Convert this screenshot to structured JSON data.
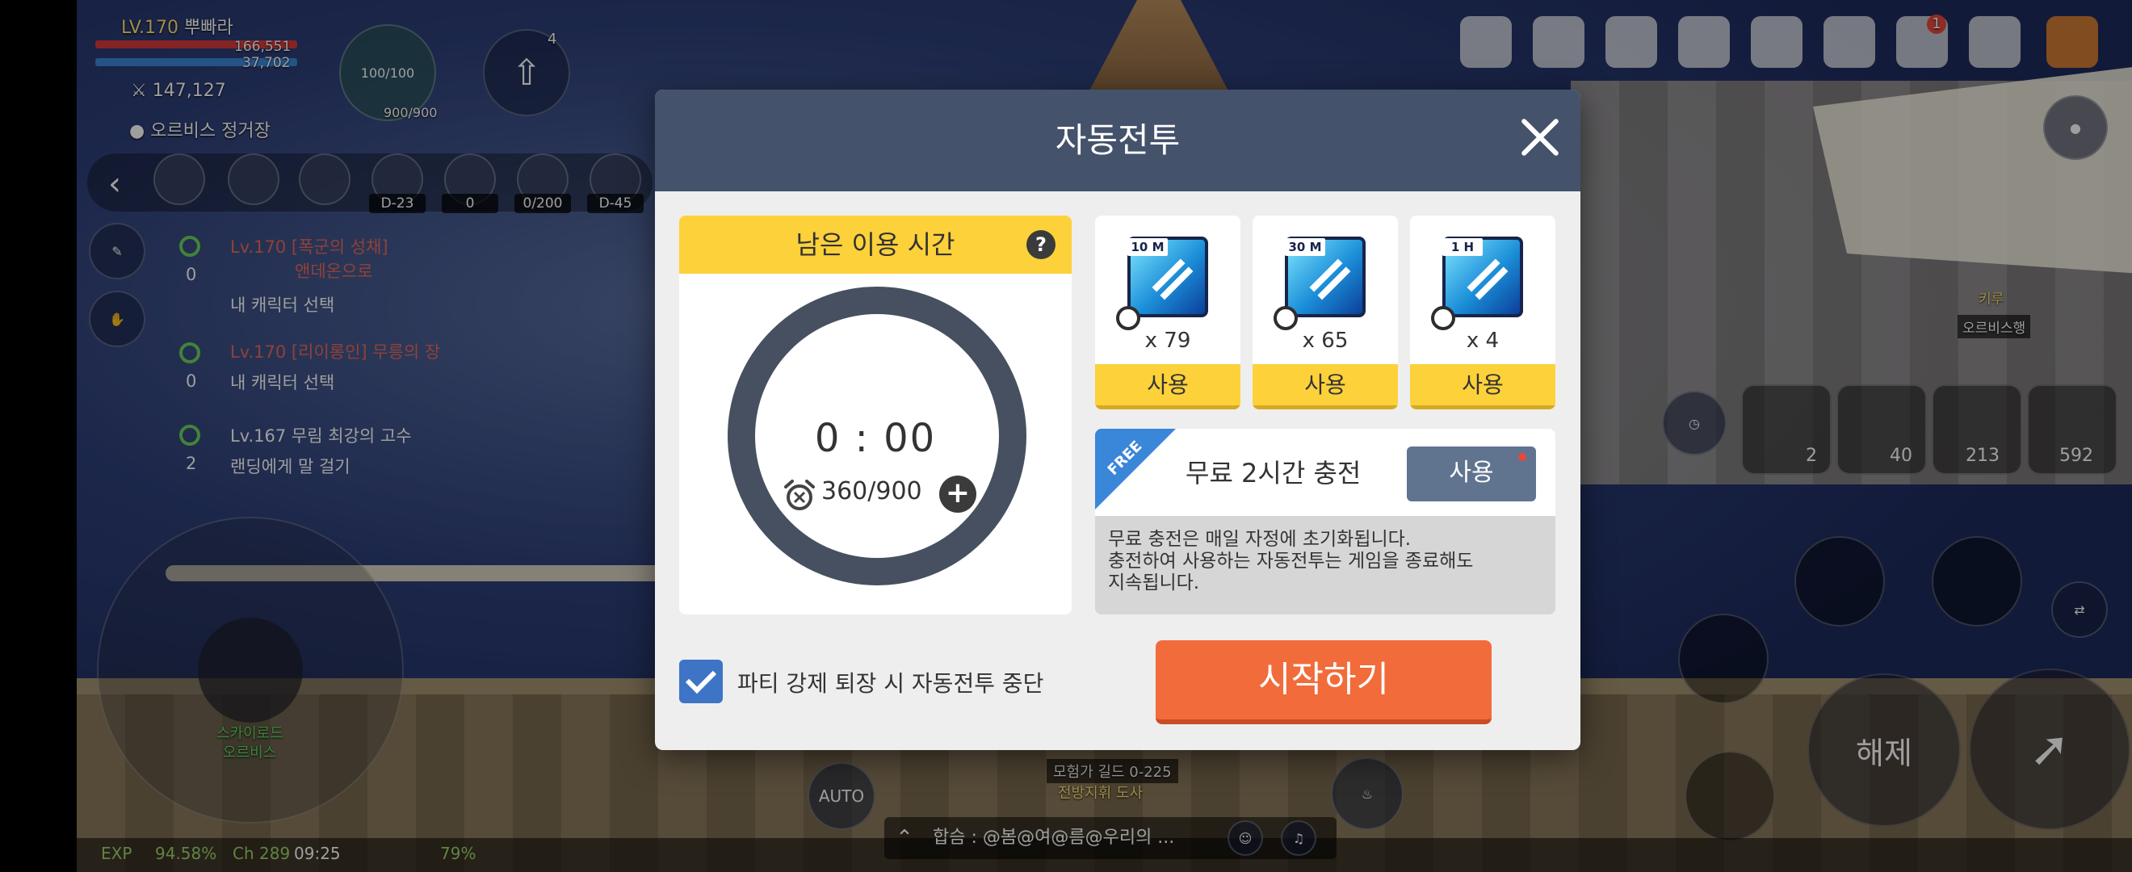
{
  "hud": {
    "level": "LV.170",
    "player_name": "뿌빠라",
    "hp": "166,551",
    "mp": "37,702",
    "pet_gauge": "100/100",
    "pet_gauge_2": "900/900",
    "combat_power": "147,127",
    "location": "오르비스 정거장",
    "quick_badge_count": "4",
    "icon_labels": [
      "D-23",
      "0",
      "0/200",
      "D-45"
    ],
    "quests": [
      {
        "title": "Lv.170 [폭군의 성채]",
        "subtitle": "앤데온으로",
        "count": "0",
        "action": "내 캐릭터 선택"
      },
      {
        "title": "Lv.170 [리이롱인] 무릉의 장",
        "subtitle": "",
        "count": "0",
        "action": "내 캐릭터 선택"
      },
      {
        "title": "Lv.167 무림 최강의 고수",
        "subtitle": "",
        "count": "2",
        "action": "랜딩에게 말 걸기"
      }
    ],
    "notification_badge": "1",
    "npc_name": "키루",
    "npc_title": "오르비스행",
    "slot_counts": [
      "2",
      "40",
      "213",
      "592"
    ],
    "release_label": "해제",
    "auto_label": "AUTO",
    "guild_line": "모험가 길드 0-225",
    "guild_sub": "전방지휘 도사",
    "exp_label": "EXP",
    "exp_value": "94.58%",
    "channel": "Ch 289",
    "clock": "09:25",
    "battery": "79%",
    "chat_text": "합슴 : @봄@여@름@우리의 ...",
    "area_name": "스카이로드",
    "area_sub": "오르비스"
  },
  "modal": {
    "title": "자동전투",
    "remaining_title": "남은 이용 시간",
    "time_value": "0 : 00",
    "charge_value": "360/900",
    "tickets": [
      {
        "tag": "10 M",
        "count": "x 79",
        "use_label": "사용"
      },
      {
        "tag": "30 M",
        "count": "x 65",
        "use_label": "사용"
      },
      {
        "tag": "1 H",
        "count": "x 4",
        "use_label": "사용"
      }
    ],
    "free_ribbon": "FREE",
    "free_label": "무료 2시간 충전",
    "free_use_label": "사용",
    "free_desc": [
      "무료 충전은 매일 자정에 초기화됩니다.",
      "충전하여 사용하는 자동전투는 게임을 종료해도",
      "지속됩니다."
    ],
    "checkbox_label": "파티 강제 퇴장 시 자동전투 중단",
    "checkbox_checked": true,
    "start_label": "시작하기"
  },
  "colors": {
    "header": "#45526b",
    "accent_yellow": "#fdd13a",
    "start_orange": "#f26b3a",
    "check_blue": "#3d74c6"
  }
}
